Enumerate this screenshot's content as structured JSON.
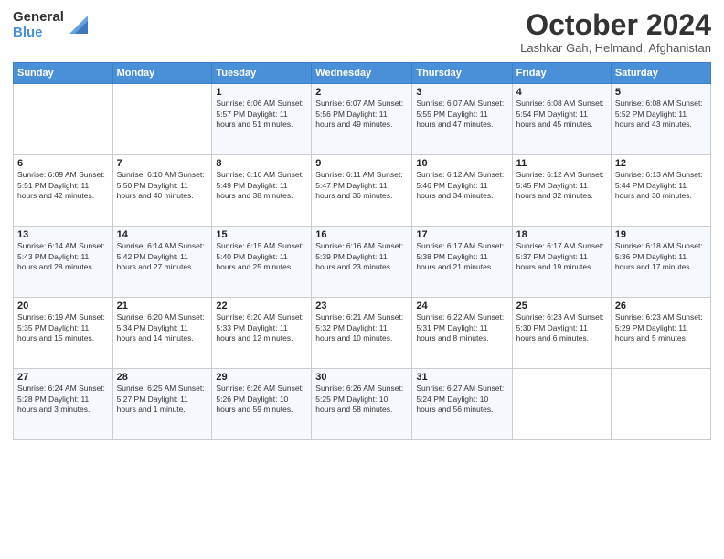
{
  "logo": {
    "line1": "General",
    "line2": "Blue"
  },
  "header": {
    "title": "October 2024",
    "subtitle": "Lashkar Gah, Helmand, Afghanistan"
  },
  "weekdays": [
    "Sunday",
    "Monday",
    "Tuesday",
    "Wednesday",
    "Thursday",
    "Friday",
    "Saturday"
  ],
  "weeks": [
    [
      {
        "day": "",
        "info": ""
      },
      {
        "day": "",
        "info": ""
      },
      {
        "day": "1",
        "info": "Sunrise: 6:06 AM\nSunset: 5:57 PM\nDaylight: 11 hours and 51 minutes."
      },
      {
        "day": "2",
        "info": "Sunrise: 6:07 AM\nSunset: 5:56 PM\nDaylight: 11 hours and 49 minutes."
      },
      {
        "day": "3",
        "info": "Sunrise: 6:07 AM\nSunset: 5:55 PM\nDaylight: 11 hours and 47 minutes."
      },
      {
        "day": "4",
        "info": "Sunrise: 6:08 AM\nSunset: 5:54 PM\nDaylight: 11 hours and 45 minutes."
      },
      {
        "day": "5",
        "info": "Sunrise: 6:08 AM\nSunset: 5:52 PM\nDaylight: 11 hours and 43 minutes."
      }
    ],
    [
      {
        "day": "6",
        "info": "Sunrise: 6:09 AM\nSunset: 5:51 PM\nDaylight: 11 hours and 42 minutes."
      },
      {
        "day": "7",
        "info": "Sunrise: 6:10 AM\nSunset: 5:50 PM\nDaylight: 11 hours and 40 minutes."
      },
      {
        "day": "8",
        "info": "Sunrise: 6:10 AM\nSunset: 5:49 PM\nDaylight: 11 hours and 38 minutes."
      },
      {
        "day": "9",
        "info": "Sunrise: 6:11 AM\nSunset: 5:47 PM\nDaylight: 11 hours and 36 minutes."
      },
      {
        "day": "10",
        "info": "Sunrise: 6:12 AM\nSunset: 5:46 PM\nDaylight: 11 hours and 34 minutes."
      },
      {
        "day": "11",
        "info": "Sunrise: 6:12 AM\nSunset: 5:45 PM\nDaylight: 11 hours and 32 minutes."
      },
      {
        "day": "12",
        "info": "Sunrise: 6:13 AM\nSunset: 5:44 PM\nDaylight: 11 hours and 30 minutes."
      }
    ],
    [
      {
        "day": "13",
        "info": "Sunrise: 6:14 AM\nSunset: 5:43 PM\nDaylight: 11 hours and 28 minutes."
      },
      {
        "day": "14",
        "info": "Sunrise: 6:14 AM\nSunset: 5:42 PM\nDaylight: 11 hours and 27 minutes."
      },
      {
        "day": "15",
        "info": "Sunrise: 6:15 AM\nSunset: 5:40 PM\nDaylight: 11 hours and 25 minutes."
      },
      {
        "day": "16",
        "info": "Sunrise: 6:16 AM\nSunset: 5:39 PM\nDaylight: 11 hours and 23 minutes."
      },
      {
        "day": "17",
        "info": "Sunrise: 6:17 AM\nSunset: 5:38 PM\nDaylight: 11 hours and 21 minutes."
      },
      {
        "day": "18",
        "info": "Sunrise: 6:17 AM\nSunset: 5:37 PM\nDaylight: 11 hours and 19 minutes."
      },
      {
        "day": "19",
        "info": "Sunrise: 6:18 AM\nSunset: 5:36 PM\nDaylight: 11 hours and 17 minutes."
      }
    ],
    [
      {
        "day": "20",
        "info": "Sunrise: 6:19 AM\nSunset: 5:35 PM\nDaylight: 11 hours and 15 minutes."
      },
      {
        "day": "21",
        "info": "Sunrise: 6:20 AM\nSunset: 5:34 PM\nDaylight: 11 hours and 14 minutes."
      },
      {
        "day": "22",
        "info": "Sunrise: 6:20 AM\nSunset: 5:33 PM\nDaylight: 11 hours and 12 minutes."
      },
      {
        "day": "23",
        "info": "Sunrise: 6:21 AM\nSunset: 5:32 PM\nDaylight: 11 hours and 10 minutes."
      },
      {
        "day": "24",
        "info": "Sunrise: 6:22 AM\nSunset: 5:31 PM\nDaylight: 11 hours and 8 minutes."
      },
      {
        "day": "25",
        "info": "Sunrise: 6:23 AM\nSunset: 5:30 PM\nDaylight: 11 hours and 6 minutes."
      },
      {
        "day": "26",
        "info": "Sunrise: 6:23 AM\nSunset: 5:29 PM\nDaylight: 11 hours and 5 minutes."
      }
    ],
    [
      {
        "day": "27",
        "info": "Sunrise: 6:24 AM\nSunset: 5:28 PM\nDaylight: 11 hours and 3 minutes."
      },
      {
        "day": "28",
        "info": "Sunrise: 6:25 AM\nSunset: 5:27 PM\nDaylight: 11 hours and 1 minute."
      },
      {
        "day": "29",
        "info": "Sunrise: 6:26 AM\nSunset: 5:26 PM\nDaylight: 10 hours and 59 minutes."
      },
      {
        "day": "30",
        "info": "Sunrise: 6:26 AM\nSunset: 5:25 PM\nDaylight: 10 hours and 58 minutes."
      },
      {
        "day": "31",
        "info": "Sunrise: 6:27 AM\nSunset: 5:24 PM\nDaylight: 10 hours and 56 minutes."
      },
      {
        "day": "",
        "info": ""
      },
      {
        "day": "",
        "info": ""
      }
    ]
  ]
}
